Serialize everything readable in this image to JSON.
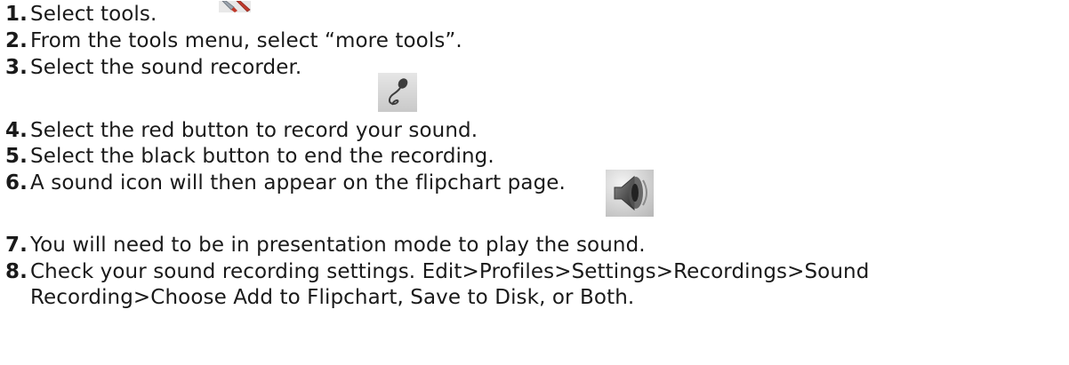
{
  "steps": [
    {
      "num": "1.",
      "text": "Select tools."
    },
    {
      "num": "2.",
      "text": "From the tools menu, select “more tools”."
    },
    {
      "num": "3.",
      "text": "Select the sound recorder."
    },
    {
      "num": "4.",
      "text": "Select the red button to record your sound."
    },
    {
      "num": "5.",
      "text": "Select the black button to end the recording."
    },
    {
      "num": "6.",
      "text": "A sound icon will then appear on the flipchart page."
    },
    {
      "num": "7.",
      "text": "You will need to be in presentation mode to play the sound."
    },
    {
      "num": "8.",
      "text": "Check your sound recording settings.  Edit>Profiles>Settings>Recordings>Sound",
      "text2": "Recording>Choose Add to Flipchart, Save to Disk, or Both."
    }
  ],
  "icons": {
    "tools": "tools-icon",
    "recorder": "microphone-icon",
    "sound": "speaker-icon",
    "tools_colors": {
      "handle": "#c0392b",
      "metal": "#9aa3ad"
    },
    "recorder_bg": "#d9d9d9",
    "speaker_bg": "#dcdcdc"
  }
}
